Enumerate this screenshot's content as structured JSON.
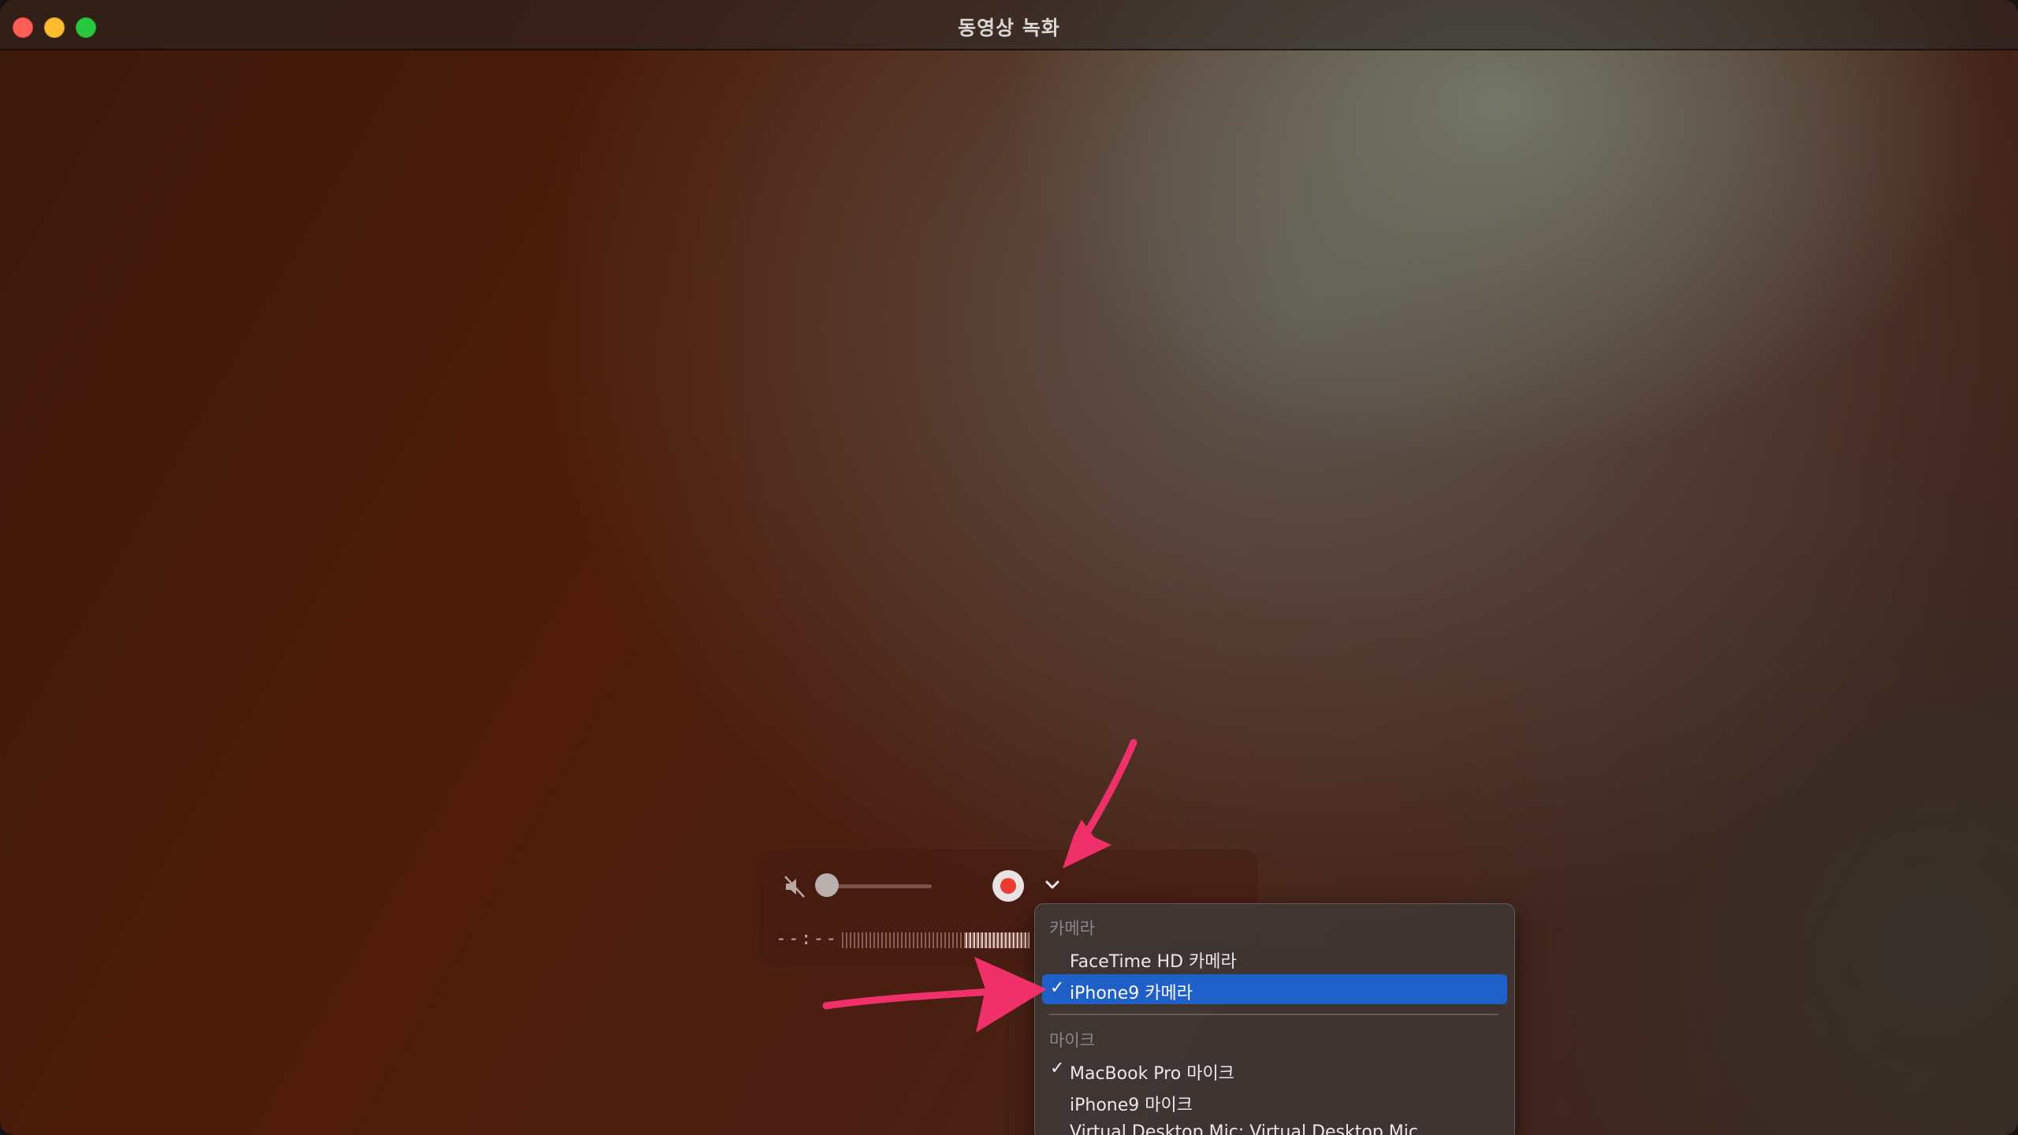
{
  "window": {
    "title": "동영상 녹화"
  },
  "controls": {
    "timer": "--:--",
    "volume_level": 0.0,
    "muted": true
  },
  "menu": {
    "camera_header": "카메라",
    "camera_items": [
      {
        "label": "FaceTime HD 카메라",
        "checked": false,
        "selected": false
      },
      {
        "label": "iPhone9 카메라",
        "checked": true,
        "selected": true
      }
    ],
    "mic_header": "마이크",
    "mic_items": [
      {
        "label": "MacBook Pro 마이크",
        "checked": true
      },
      {
        "label": "iPhone9 마이크",
        "checked": false
      },
      {
        "label": "Virtual Desktop Mic: Virtual Desktop Mic",
        "checked": false
      }
    ],
    "check_glyph": "✓"
  },
  "colors": {
    "selection": "#1f5fc8",
    "record_red": "#ec3b30",
    "annotation_arrow": "#f0306a",
    "close": "#fe5f57",
    "minimize": "#febc2e",
    "maximize": "#28c840"
  }
}
